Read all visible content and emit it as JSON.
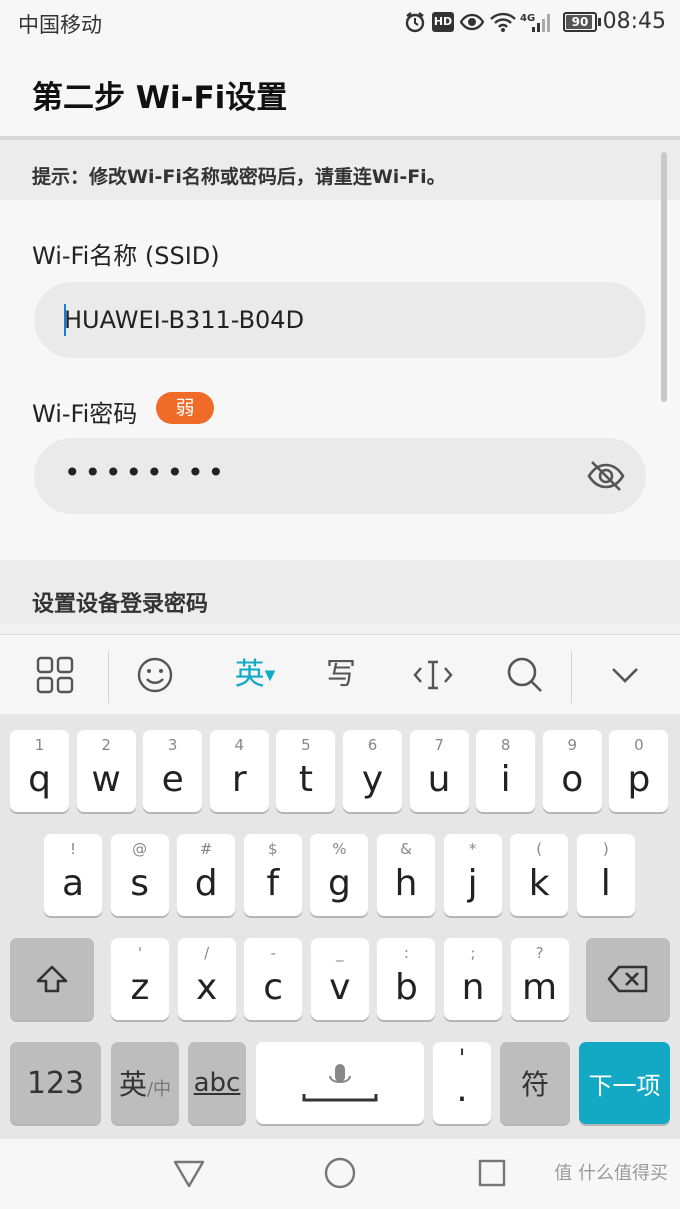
{
  "status_bar": {
    "carrier": "中国移动",
    "time": "08:45",
    "battery": "90",
    "network": "4G",
    "hd": "HD"
  },
  "page": {
    "title": "第二步 Wi-Fi设置",
    "hint": "提示：修改Wi-Fi名称或密码后，请重连Wi-Fi。",
    "ssid_label": "Wi-Fi名称 (SSID)",
    "ssid_value": "HUAWEI-B311-B04D",
    "password_label": "Wi-Fi密码",
    "password_strength": "弱",
    "password_masked": "••••••••",
    "section_title": "设置设备登录密码"
  },
  "keyboard": {
    "mode": "英",
    "toolbar": {
      "write": "写"
    },
    "row1": [
      {
        "key": "q",
        "hint": "1"
      },
      {
        "key": "w",
        "hint": "2"
      },
      {
        "key": "e",
        "hint": "3"
      },
      {
        "key": "r",
        "hint": "4"
      },
      {
        "key": "t",
        "hint": "5"
      },
      {
        "key": "y",
        "hint": "6"
      },
      {
        "key": "u",
        "hint": "7"
      },
      {
        "key": "i",
        "hint": "8"
      },
      {
        "key": "o",
        "hint": "9"
      },
      {
        "key": "p",
        "hint": "0"
      }
    ],
    "row2": [
      {
        "key": "a",
        "hint": "!"
      },
      {
        "key": "s",
        "hint": "@"
      },
      {
        "key": "d",
        "hint": "#"
      },
      {
        "key": "f",
        "hint": "$"
      },
      {
        "key": "g",
        "hint": "%"
      },
      {
        "key": "h",
        "hint": "&"
      },
      {
        "key": "j",
        "hint": "*"
      },
      {
        "key": "k",
        "hint": "("
      },
      {
        "key": "l",
        "hint": ")"
      }
    ],
    "row3": [
      {
        "key": "z",
        "hint": "'"
      },
      {
        "key": "x",
        "hint": "/"
      },
      {
        "key": "c",
        "hint": "-"
      },
      {
        "key": "v",
        "hint": "_"
      },
      {
        "key": "b",
        "hint": ":"
      },
      {
        "key": "n",
        "hint": ";"
      },
      {
        "key": "m",
        "hint": "?"
      }
    ],
    "num_key": "123",
    "lang_key": "英",
    "lang_key_sub": "/中",
    "abc_key": "abc",
    "period_hint": "'",
    "period_key": ".",
    "symbol_key": "符",
    "next_key": "下一项"
  },
  "watermark": "值 什么值得买",
  "colors": {
    "accent": "#13a9c4",
    "weak_badge": "#f06a28",
    "caret": "#1a7cd8"
  }
}
